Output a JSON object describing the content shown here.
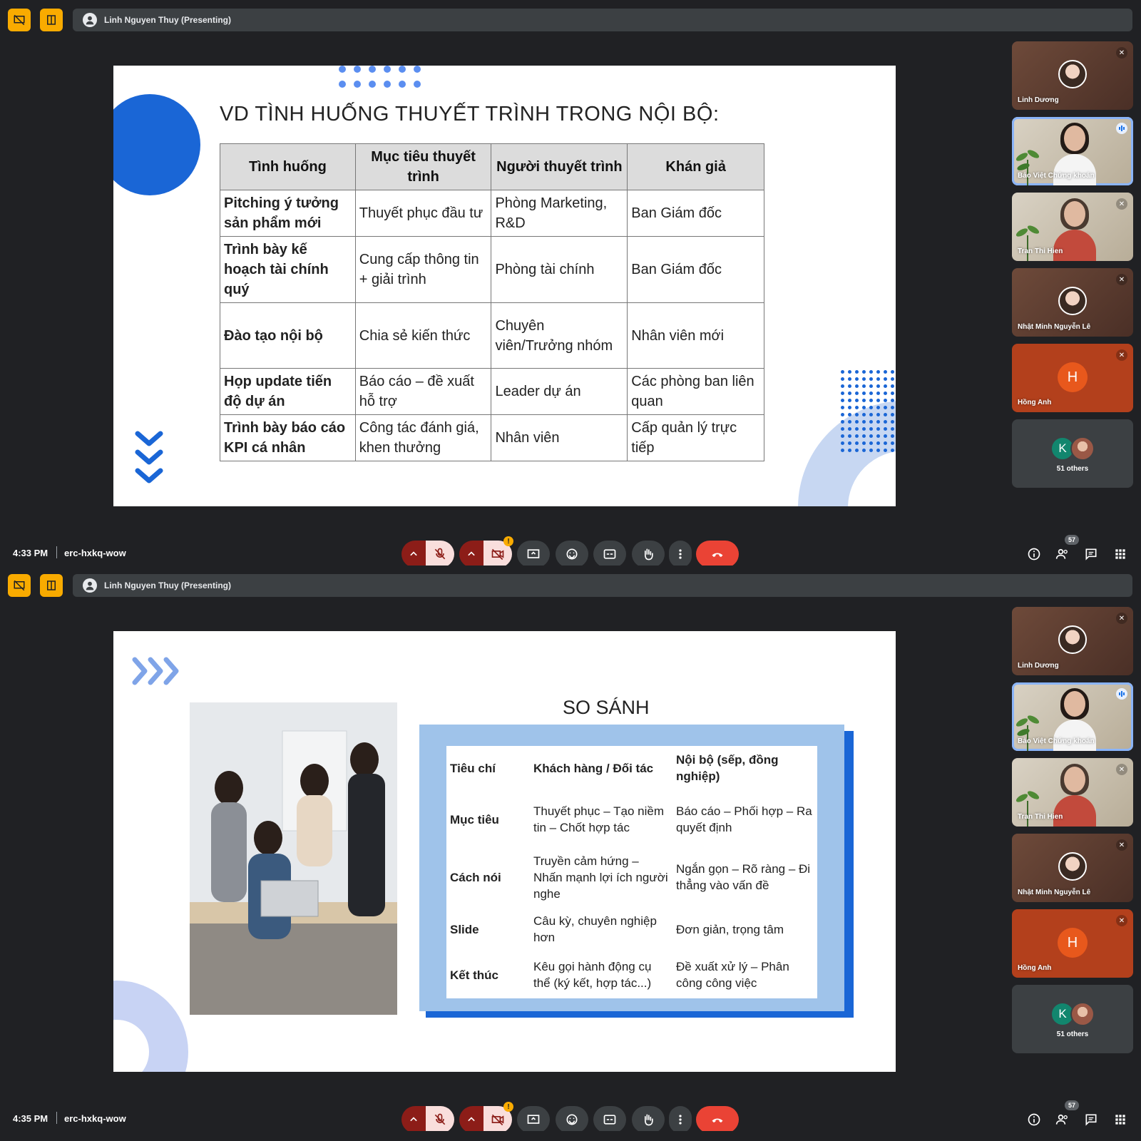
{
  "screens": [
    {
      "presenter": "Linh Nguyen Thuy (Presenting)",
      "time": "4:33 PM",
      "meeting_code": "erc-hxkq-wow",
      "participant_count": "57",
      "slide": {
        "title": "VD TÌNH HUỐNG THUYẾT TRÌNH TRONG NỘI BỘ:",
        "headers": [
          "Tình huống",
          "Mục tiêu thuyết trình",
          "Người thuyết trình",
          "Khán giả"
        ],
        "rows": [
          [
            "Pitching ý tưởng sản phẩm mới",
            "Thuyết phục đầu tư",
            "Phòng Marketing, R&D",
            "Ban Giám đốc"
          ],
          [
            "Trình bày kế hoạch tài chính quý",
            "Cung cấp thông tin + giải trình",
            "Phòng tài chính",
            "Ban Giám đốc"
          ],
          [
            "Đào tạo nội bộ",
            "Chia sẻ kiến thức",
            "Chuyên viên/Trưởng nhóm",
            "Nhân viên mới"
          ],
          [
            "Họp update tiến độ dự án",
            "Báo cáo – đề xuất hỗ trợ",
            "Leader dự án",
            "Các phòng ban liên quan"
          ],
          [
            "Trình bày báo cáo KPI cá nhân",
            "Công tác đánh giá, khen thưởng",
            "Nhân viên",
            "Cấp quản lý trực tiếp"
          ]
        ]
      }
    },
    {
      "presenter": "Linh Nguyen Thuy (Presenting)",
      "time": "4:35 PM",
      "meeting_code": "erc-hxkq-wow",
      "participant_count": "57",
      "slide": {
        "title": "SO SÁNH",
        "headers": [
          "Tiêu chí",
          "Khách hàng / Đối tác",
          "Nội bộ (sếp, đồng nghiệp)"
        ],
        "rows": [
          [
            "Mục tiêu",
            "Thuyết phục – Tạo niềm tin – Chốt hợp tác",
            "Báo cáo – Phối hợp – Ra quyết định"
          ],
          [
            "Cách nói",
            "Truyền cảm hứng – Nhấn mạnh lợi ích người nghe",
            "Ngắn gọn – Rõ ràng – Đi thẳng vào vấn đề"
          ],
          [
            "Slide",
            "Câu kỳ, chuyên nghiệp hơn",
            "Đơn giản, trọng tâm"
          ],
          [
            "Kết thúc",
            "Kêu gọi hành động cụ thể (ký kết, hợp tác...)",
            "Đề xuất xử lý – Phân công công việc"
          ]
        ]
      }
    }
  ],
  "participants": [
    {
      "name": "Linh Dương",
      "state": "muted"
    },
    {
      "name": "Bảo Việt Chứng khoán",
      "state": "speaking"
    },
    {
      "name": "Tran Thi Hien",
      "state": "muted"
    },
    {
      "name": "Nhật Minh Nguyễn Lê",
      "state": "muted"
    },
    {
      "name": "Hồng Anh",
      "initial": "H",
      "state": "muted"
    },
    {
      "initial": "K",
      "label": "51 others"
    }
  ],
  "participants_screen2_names": [
    "Linh Dương",
    "Bảo Việt Chứng khoán",
    "Tran Thi Hien",
    "Nhật Minh Nguyễn Lê",
    "Hồng Anh",
    "51 others"
  ],
  "colors": {
    "background": "#202124",
    "accent_yellow": "#f9ab00",
    "end_call_red": "#ea4335",
    "slide_blue": "#1a66d6"
  }
}
